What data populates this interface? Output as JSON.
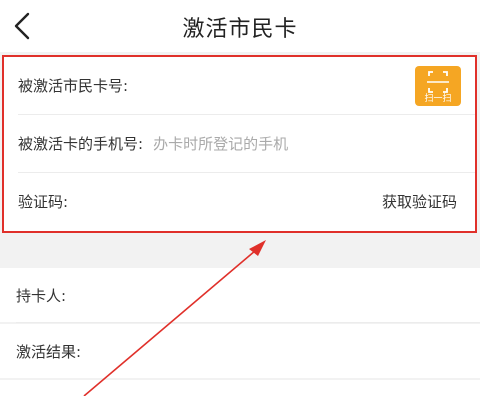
{
  "header": {
    "title": "激活市民卡",
    "back_icon": "chevron-left-icon"
  },
  "form": {
    "card_number_label": "被激活市民卡号:",
    "scan_button_label": "扫一扫",
    "phone_label": "被激活卡的手机号:",
    "phone_placeholder": "办卡时所登记的手机",
    "code_label": "验证码:",
    "get_code_label": "获取验证码"
  },
  "info": {
    "holder_label": "持卡人:",
    "result_label": "激活结果:"
  },
  "colors": {
    "accent": "#f5a623",
    "highlight": "#e0302a"
  }
}
